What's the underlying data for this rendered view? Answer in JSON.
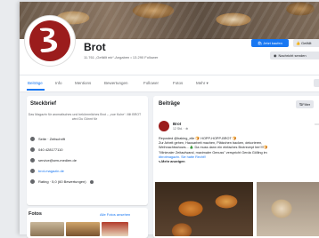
{
  "page": {
    "name": "Brot",
    "stats": "11.761 „Gefällt mir“-Angaben • 13.290 Follower",
    "primary_button": "Jetzt kaufen",
    "like_button": "Gefällt",
    "message_button": "Nachricht senden"
  },
  "tabs": [
    "Beiträge",
    "Info",
    "Mentions",
    "Bewertungen",
    "Follower",
    "Fotos",
    "Mehr ▾"
  ],
  "steckbrief": {
    "title": "Steckbrief",
    "description": "Das Magazin für aromatisches und bekömmliches Brot – „vue Kuhe“. Mit BROT wird Du Gönnt für",
    "rows": [
      {
        "icon": "info-icon",
        "text": "Seite · Zeitschrift"
      },
      {
        "icon": "phone-icon",
        "text": "040 428177110"
      },
      {
        "icon": "email-icon",
        "text": "service@wm-medien.de"
      },
      {
        "icon": "globe-icon",
        "text": "brot-magazin.de"
      },
      {
        "icon": "star-icon",
        "text": "Rating · 5,0 (60 Bewertungen)"
      }
    ]
  },
  "photos": {
    "title": "Fotos",
    "link": "Alle Fotos ansehen"
  },
  "posts": {
    "title": "Beiträge",
    "filter": "Filter",
    "author": "Brot",
    "time": "12 Std. · ⊕",
    "lines": [
      "Reposted @baking_elle 🍞 HOPP-HOPP-BROT 🍞",
      "Zur Arbeit gehen, Hausarbeit machen, Plätzchen backen, dekorieren,",
      "Weihnachtsshows... 🎄 Da muss dann ein einfaches Brotrezept her!!!!🍞",
      "\"Minimaler Zeitaufwand, maximaler Genuss\" verspricht Gerda Gölling im",
      "#brotmagazin. Sie hatte Recht!!",
      "⤷ Mehr anzeigen"
    ]
  },
  "colors": {
    "accent": "#1877f2",
    "brand": "#9b1c1c",
    "page_bg": "#f0f2f5"
  }
}
